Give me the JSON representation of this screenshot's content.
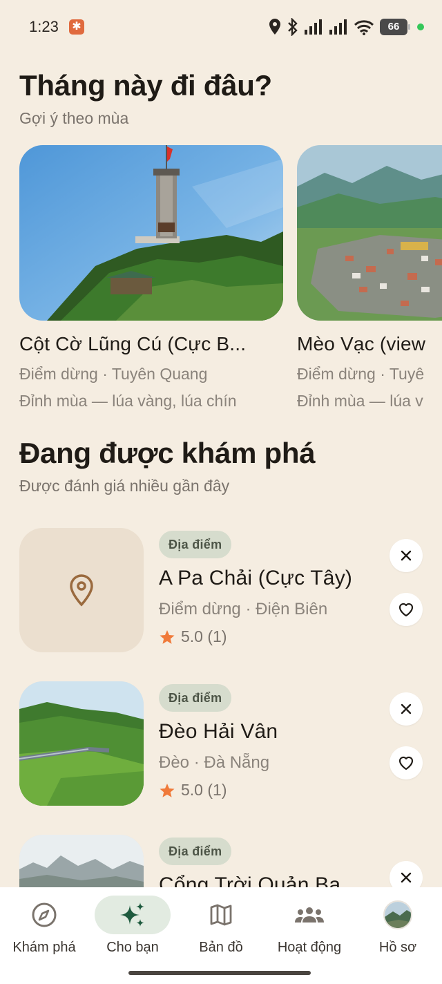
{
  "status_bar": {
    "time": "1:23",
    "battery": "66",
    "icons": [
      "notification-app-icon",
      "location-icon",
      "bluetooth-icon",
      "signal-icon",
      "signal-icon",
      "wifi-icon",
      "battery-icon"
    ]
  },
  "seasonal": {
    "title": "Tháng này đi đâu?",
    "subtitle": "Gợi ý theo mùa",
    "cards": [
      {
        "name": "Cột Cờ Lũng Cú (Cực B...",
        "meta": "Điểm dừng · Tuyên Quang",
        "desc": "Đỉnh mùa — lúa vàng, lúa chín"
      },
      {
        "name": "Mèo Vạc (view",
        "meta": "Điểm dừng · Tuyê",
        "desc": "Đỉnh mùa — lúa v"
      }
    ]
  },
  "trending": {
    "title": "Đang được khám phá",
    "subtitle": "Được đánh giá nhiều gần đây",
    "items": [
      {
        "tag": "Địa điểm",
        "name": "A Pa Chải (Cực Tây)",
        "meta": "Điểm dừng · Điện Biên",
        "rating": "5.0 (1)"
      },
      {
        "tag": "Địa điểm",
        "name": "Đèo Hải Vân",
        "meta": "Đèo · Đà Nẵng",
        "rating": "5.0 (1)"
      },
      {
        "tag": "Địa điểm",
        "name": "Cổng Trời Quản Ba"
      }
    ]
  },
  "nav": {
    "items": [
      {
        "label": "Khám phá",
        "icon": "compass-icon"
      },
      {
        "label": "Cho bạn",
        "icon": "sparkle-icon",
        "active": true
      },
      {
        "label": "Bản đồ",
        "icon": "map-icon"
      },
      {
        "label": "Hoạt động",
        "icon": "groups-icon"
      },
      {
        "label": "Hồ sơ",
        "icon": "avatar"
      }
    ]
  },
  "colors": {
    "background": "#f5ede1",
    "tag_bg": "#d6dccd",
    "active_nav_bg": "#e2ebe1",
    "star": "#f07a3a",
    "pin": "#9a6a3e"
  }
}
